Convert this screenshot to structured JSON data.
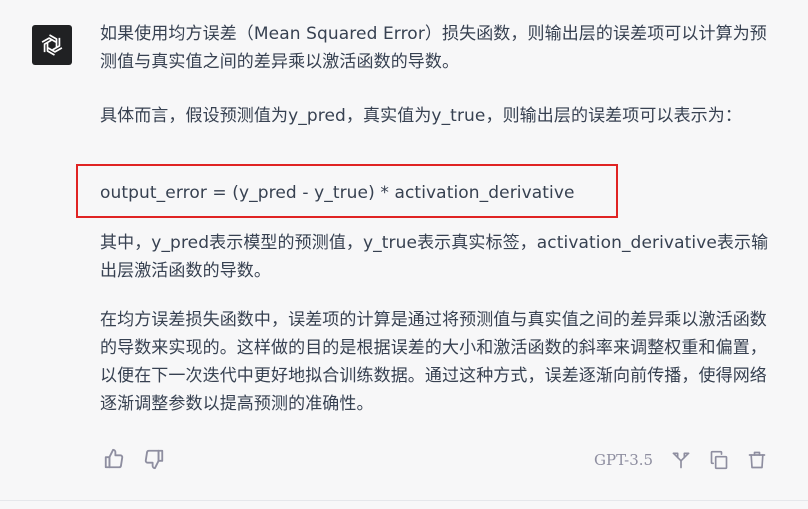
{
  "message": {
    "paragraphs": {
      "p1": "如果使用均方误差（Mean Squared Error）损失函数，则输出层的误差项可以计算为预测值与真实值之间的差异乘以激活函数的导数。",
      "p2": "具体而言，假设预测值为y_pred，真实值为y_true，则输出层的误差项可以表示为：",
      "formula": "output_error = (y_pred - y_true) * activation_derivative",
      "p3": "其中，y_pred表示模型的预测值，y_true表示真实标签，activation_derivative表示输出层激活函数的导数。",
      "p4": "在均方误差损失函数中，误差项的计算是通过将预测值与真实值之间的差异乘以激活函数的导数来实现的。这样做的目的是根据误差的大小和激活函数的斜率来调整权重和偏置，以便在下一次迭代中更好地拟合训练数据。通过这种方式，误差逐渐向前传播，使得网络逐渐调整参数以提高预测的准确性。"
    }
  },
  "actions": {
    "model_label": "GPT-3.5",
    "icons": [
      "thumbs-up-icon",
      "thumbs-down-icon",
      "regenerate-icon",
      "copy-icon",
      "delete-icon"
    ]
  },
  "colors": {
    "background": "#f7f7f8",
    "text": "#374151",
    "avatar_bg": "#202123",
    "highlight_border": "#e02424",
    "icon": "#8e8ea0"
  }
}
